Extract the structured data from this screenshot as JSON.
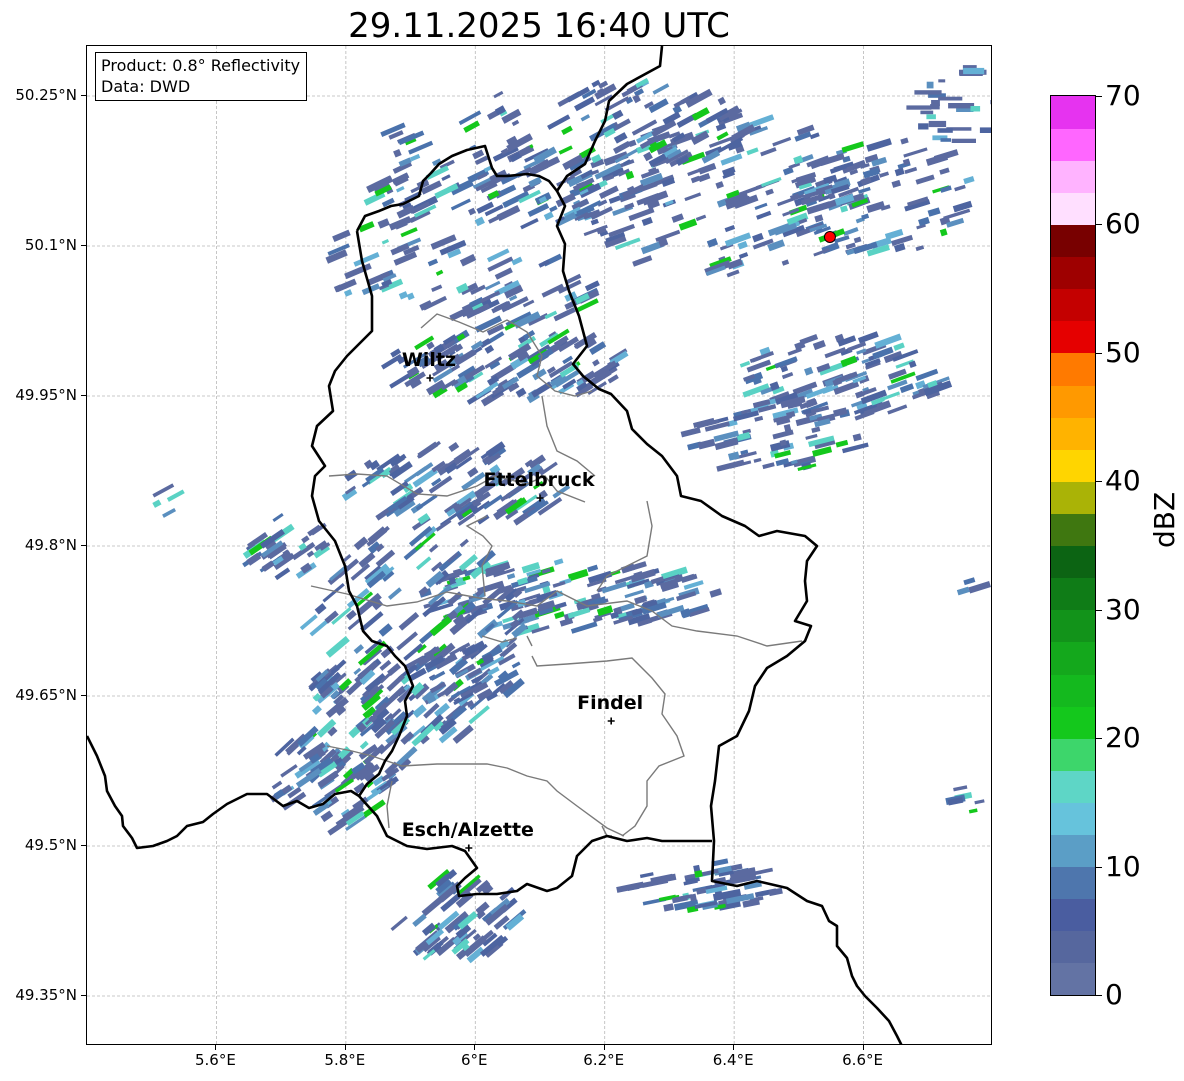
{
  "title": "29.11.2025 16:40 UTC",
  "info_box": {
    "product": "Product: 0.8° Reflectivity",
    "data": "Data: DWD"
  },
  "axes": {
    "lat_ticks": [
      "50.25°N",
      "50.1°N",
      "49.95°N",
      "49.8°N",
      "49.65°N",
      "49.5°N",
      "49.35°N"
    ],
    "lon_ticks": [
      "5.6°E",
      "5.8°E",
      "6°E",
      "6.2°E",
      "6.4°E",
      "6.6°E"
    ],
    "lat_values": [
      50.25,
      50.1,
      49.95,
      49.8,
      49.65,
      49.5,
      49.35
    ],
    "lon_values": [
      5.6,
      5.8,
      6.0,
      6.2,
      6.4,
      6.6
    ],
    "lat_range": [
      49.3,
      50.3
    ],
    "lon_range": [
      5.4,
      6.8
    ],
    "grid": true
  },
  "cities": [
    {
      "name": "Wiltz",
      "lon": 5.93,
      "lat": 49.968
    },
    {
      "name": "Ettelbruck",
      "lon": 6.1,
      "lat": 49.848
    },
    {
      "name": "Findel",
      "lon": 6.21,
      "lat": 49.625
    },
    {
      "name": "Esch/Alzette",
      "lon": 5.99,
      "lat": 49.498
    }
  ],
  "radar_site": {
    "lon": 6.548,
    "lat": 50.109,
    "color": "#ff0000"
  },
  "colorbar": {
    "unit": "dBZ",
    "min": 0,
    "max": 70,
    "tick_labels": [
      "0",
      "10",
      "20",
      "30",
      "40",
      "50",
      "60",
      "70"
    ],
    "colors": [
      "#6373a4",
      "#56679e",
      "#4a5da0",
      "#4e76ad",
      "#5b9ec6",
      "#66c3dc",
      "#5ed6c6",
      "#3dd66b",
      "#14c81c",
      "#14b91e",
      "#14a81c",
      "#12931a",
      "#0f7c17",
      "#0c6413",
      "#3f7710",
      "#aab306",
      "#ffd500",
      "#ffb300",
      "#ff9900",
      "#ff7a00",
      "#e50000",
      "#c40000",
      "#9e0000",
      "#780000",
      "#ffdfff",
      "#ffb3ff",
      "#ff66ff",
      "#e633f0"
    ]
  },
  "chart_data": {
    "type": "radar map",
    "title": "29.11.2025 16:40 UTC",
    "variable": "0.8° Reflectivity",
    "source": "DWD",
    "unit": "dBZ",
    "scale": [
      0,
      70
    ],
    "echo_bands": [
      {
        "lon": [
          5.95,
          6.25
        ],
        "lat": [
          49.95,
          50.02
        ],
        "max_dbz": 25
      },
      {
        "lon": [
          6.04,
          6.38
        ],
        "lat": [
          49.73,
          49.8
        ],
        "max_dbz": 25
      },
      {
        "lon": [
          5.7,
          6.0
        ],
        "lat": [
          49.55,
          49.8
        ],
        "max_dbz": 20
      },
      {
        "lon": [
          6.38,
          6.78
        ],
        "lat": [
          49.9,
          50.3
        ],
        "max_dbz": 17
      }
    ]
  }
}
